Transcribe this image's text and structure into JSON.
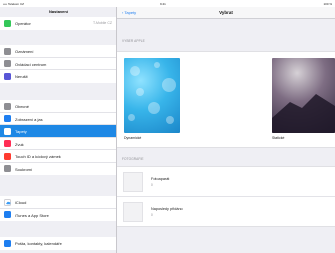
{
  "status": {
    "carrier": "•••• Telekom CZ",
    "time": "9:41",
    "battery": "100 %"
  },
  "sidebar": {
    "title": "Nastavení",
    "groups": [
      [
        {
          "label": "Operátor",
          "detail": "T-Mobile CZ",
          "icon_color": "#34c759",
          "icon": "phone-icon"
        }
      ],
      [
        {
          "label": "Oznámení",
          "icon_color": "#8e8e93",
          "icon": "notifications-icon"
        },
        {
          "label": "Ovládací centrum",
          "icon_color": "#8e8e93",
          "icon": "control-center-icon"
        },
        {
          "label": "Nerušit",
          "icon_color": "#5856d6",
          "icon": "moon-icon"
        }
      ],
      [
        {
          "label": "Obecné",
          "icon_color": "#8e8e93",
          "icon": "gear-icon"
        },
        {
          "label": "Zobrazení a jas",
          "icon_color": "#1e7ef0",
          "icon": "brightness-icon"
        },
        {
          "label": "Tapety",
          "icon_color": "#1e88e5",
          "icon": "wallpaper-icon",
          "selected": true
        },
        {
          "label": "Zvuk",
          "icon_color": "#ff2d55",
          "icon": "sound-icon"
        },
        {
          "label": "Touch ID a kódový zámek",
          "icon_color": "#ff3b30",
          "icon": "fingerprint-icon"
        },
        {
          "label": "Soukromí",
          "icon_color": "#8e8e93",
          "icon": "hand-icon"
        }
      ],
      [
        {
          "label": "iCloud",
          "icon_color": "#ffffff",
          "icon": "cloud-icon"
        },
        {
          "label": "iTunes a App Store",
          "icon_color": "#1e7ef0",
          "icon": "app-store-icon"
        }
      ],
      [
        {
          "label": "Pošta, kontakty, kalendáře",
          "icon_color": "#1e7ef0",
          "icon": "mail-icon"
        }
      ]
    ]
  },
  "main": {
    "back_label": "Tapety",
    "title": "Vybrat",
    "wallpapers_header": "VYBER APPLE",
    "wallpapers": [
      {
        "label": "Dynamické"
      },
      {
        "label": "Statické"
      }
    ],
    "photos_header": "FOTOGRAFIE",
    "photos": [
      {
        "title": "Fotoaparát",
        "count": "0"
      },
      {
        "title": "Naposledy přidáno",
        "count": "0"
      }
    ]
  }
}
